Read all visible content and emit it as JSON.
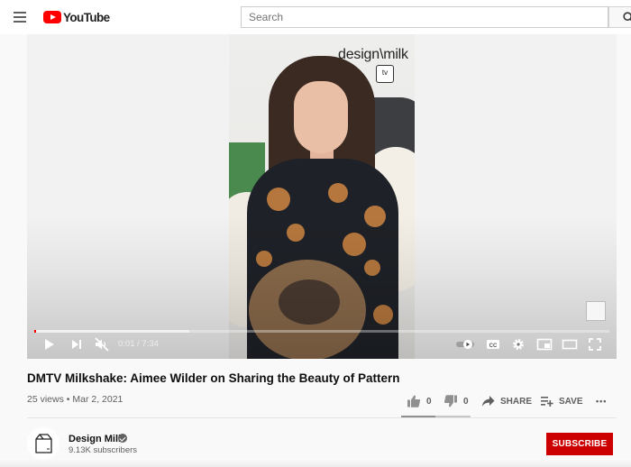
{
  "header": {
    "logo_text": "YouTube",
    "search_placeholder": "Search"
  },
  "player": {
    "brand_text": "design\\milk",
    "brand_badge": "tv",
    "time": "0:01 / 7:34",
    "progress_played_fraction": 0.003,
    "progress_buffered_fraction": 0.27,
    "controls": [
      "play-icon",
      "next-icon",
      "mute-icon",
      "autoplay-toggle",
      "cc-icon",
      "settings-icon",
      "miniplayer-icon",
      "theater-icon",
      "fullscreen-icon"
    ]
  },
  "video": {
    "title": "DMTV Milkshake: Aimee Wilder on Sharing the Beauty of Pattern",
    "meta": "25 views • Mar 2, 2021",
    "likes": "0",
    "dislikes": "0",
    "share_label": "SHARE",
    "save_label": "SAVE",
    "more_label": "•••"
  },
  "channel": {
    "name": "Design Milk",
    "subscribers": "9.13K subscribers",
    "subscribe_label": "SUBSCRIBE"
  },
  "colors": {
    "accent": "#ff0000",
    "subscribe": "#cc0000",
    "text_secondary": "#606060"
  }
}
